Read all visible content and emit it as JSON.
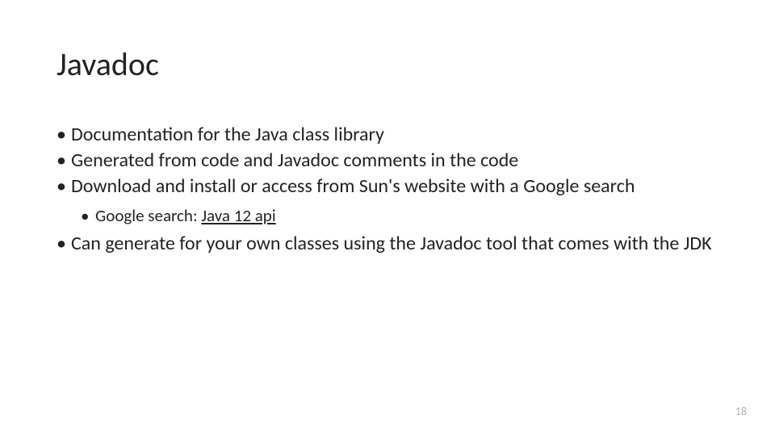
{
  "title": "Javadoc",
  "bullets": [
    {
      "text": "Documentation for the Java class library"
    },
    {
      "text": "Generated from code and Javadoc comments in the code"
    },
    {
      "text": "Download and install or access from Sun's website with a Google search"
    }
  ],
  "subBullet": {
    "prefix": "Google search: ",
    "link": "Java 12 api"
  },
  "bullets2": [
    {
      "text": "Can generate for your own classes using the Javadoc tool that comes with the JDK"
    }
  ],
  "pageNumber": "18"
}
